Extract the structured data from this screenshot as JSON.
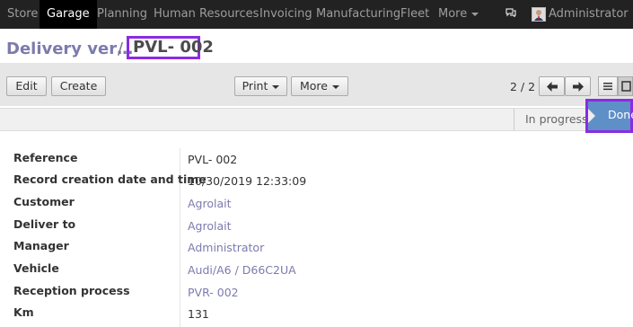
{
  "nav": {
    "items": [
      "Store",
      "Garage",
      "Planning",
      "Human Resources",
      "Invoicing",
      "Manufacturing",
      "Fleet"
    ],
    "more_label": "More",
    "user_label": "Administrator"
  },
  "breadcrumb": {
    "parent": "Delivery ver…",
    "separator": "/",
    "current": "PVL- 002"
  },
  "toolbar": {
    "edit_label": "Edit",
    "create_label": "Create",
    "print_label": "Print",
    "more_label": "More",
    "pager": "2 / 2"
  },
  "stages": {
    "in_progress": "In progress",
    "done": "Done"
  },
  "form": {
    "fields": [
      {
        "label": "Reference",
        "value": "PVL- 002"
      },
      {
        "label": "Record creation date and time",
        "value": "10/30/2019 12:33:09"
      },
      {
        "label": "Customer",
        "value": "Agrolait"
      },
      {
        "label": "Deliver to",
        "value": "Agrolait"
      },
      {
        "label": "Manager",
        "value": "Administrator"
      },
      {
        "label": "Vehicle",
        "value": "Audi/A6 / D66C2UA"
      },
      {
        "label": "Reception process",
        "value": "PVR- 002"
      },
      {
        "label": "Km",
        "value": "131"
      }
    ]
  },
  "colors": {
    "accent": "#7c7bad",
    "highlight": "#8a2be2",
    "nav_bg": "#222222",
    "done_stage": "#5f8fc7"
  }
}
